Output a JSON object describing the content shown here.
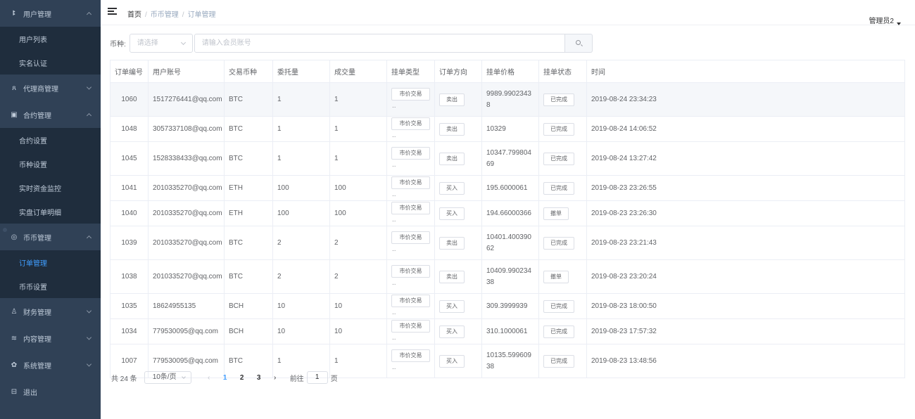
{
  "sidebar": {
    "sections": [
      {
        "label": "用户管理",
        "icon": "user-icon",
        "expanded": true,
        "children": [
          "用户列表",
          "实名认证"
        ]
      },
      {
        "label": "代理商管理",
        "icon": "agent-icon",
        "expanded": false,
        "children": []
      },
      {
        "label": "合约管理",
        "icon": "contract-icon",
        "expanded": true,
        "children": [
          "合约设置",
          "币种设置",
          "实时资金监控",
          "实盘订单明细"
        ]
      },
      {
        "label": "币币管理",
        "icon": "coin-icon",
        "expanded": true,
        "children": [
          "订单管理",
          "币币设置"
        ]
      },
      {
        "label": "财务管理",
        "icon": "finance-icon",
        "expanded": false,
        "children": []
      },
      {
        "label": "内容管理",
        "icon": "content-icon",
        "expanded": false,
        "children": []
      },
      {
        "label": "系统管理",
        "icon": "gear-icon",
        "expanded": false,
        "children": []
      },
      {
        "label": "退出",
        "icon": "logout-icon",
        "expanded": false,
        "children": []
      }
    ],
    "active_item": "订单管理"
  },
  "header": {
    "breadcrumb": [
      "首页",
      "币币管理",
      "订单管理"
    ],
    "admin_name": "管理员2"
  },
  "filters": {
    "coin_label": "币种:",
    "coin_placeholder": "请选择",
    "account_placeholder": "请输入会员账号"
  },
  "table": {
    "columns": [
      "订单编号",
      "用户账号",
      "交易币种",
      "委托量",
      "成交量",
      "挂单类型",
      "订单方向",
      "挂单价格",
      "挂单状态",
      "时间"
    ],
    "rows": [
      {
        "id": "1060",
        "account": "1517276441@qq.com",
        "coin": "BTC",
        "entrust": "1",
        "filled": "1",
        "type": "市价交易",
        "direction": "卖出",
        "price": "9989.99023438",
        "status": "已完成",
        "time": "2019-08-24 23:34:23",
        "hover": true
      },
      {
        "id": "1048",
        "account": "3057337108@qq.com",
        "coin": "BTC",
        "entrust": "1",
        "filled": "1",
        "type": "市价交易",
        "direction": "卖出",
        "price": "10329",
        "status": "已完成",
        "time": "2019-08-24 14:06:52"
      },
      {
        "id": "1045",
        "account": "1528338433@qq.com",
        "coin": "BTC",
        "entrust": "1",
        "filled": "1",
        "type": "市价交易",
        "direction": "卖出",
        "price": "10347.79980469",
        "status": "已完成",
        "time": "2019-08-24 13:27:42"
      },
      {
        "id": "1041",
        "account": "2010335270@qq.com",
        "coin": "ETH",
        "entrust": "100",
        "filled": "100",
        "type": "市价交易",
        "direction": "买入",
        "price": "195.6000061",
        "status": "已完成",
        "time": "2019-08-23 23:26:55"
      },
      {
        "id": "1040",
        "account": "2010335270@qq.com",
        "coin": "ETH",
        "entrust": "100",
        "filled": "100",
        "type": "市价交易",
        "direction": "买入",
        "price": "194.66000366",
        "status": "撤单",
        "time": "2019-08-23 23:26:30"
      },
      {
        "id": "1039",
        "account": "2010335270@qq.com",
        "coin": "BTC",
        "entrust": "2",
        "filled": "2",
        "type": "市价交易",
        "direction": "卖出",
        "price": "10401.40039062",
        "status": "已完成",
        "time": "2019-08-23 23:21:43"
      },
      {
        "id": "1038",
        "account": "2010335270@qq.com",
        "coin": "BTC",
        "entrust": "2",
        "filled": "2",
        "type": "市价交易",
        "direction": "卖出",
        "price": "10409.99023438",
        "status": "撤单",
        "time": "2019-08-23 23:20:24"
      },
      {
        "id": "1035",
        "account": "18624955135",
        "coin": "BCH",
        "entrust": "10",
        "filled": "10",
        "type": "市价交易",
        "direction": "买入",
        "price": "309.3999939",
        "status": "已完成",
        "time": "2019-08-23 18:00:50"
      },
      {
        "id": "1034",
        "account": "779530095@qq.com",
        "coin": "BCH",
        "entrust": "10",
        "filled": "10",
        "type": "市价交易",
        "direction": "买入",
        "price": "310.1000061",
        "status": "已完成",
        "time": "2019-08-23 17:57:32"
      },
      {
        "id": "1007",
        "account": "779530095@qq.com",
        "coin": "BTC",
        "entrust": "1",
        "filled": "1",
        "type": "市价交易",
        "direction": "买入",
        "price": "10135.59960938",
        "status": "已完成",
        "time": "2019-08-23 13:48:56"
      }
    ]
  },
  "pagination": {
    "total_text": "共 24 条",
    "page_size": "10条/页",
    "pages": [
      "1",
      "2",
      "3"
    ],
    "current_page": "1",
    "goto_label": "前往",
    "goto_value": "1",
    "page_suffix": "页"
  },
  "colors": {
    "sidebar_bg": "#304156",
    "submenu_bg": "#1f2d3d",
    "accent": "#409eff"
  }
}
